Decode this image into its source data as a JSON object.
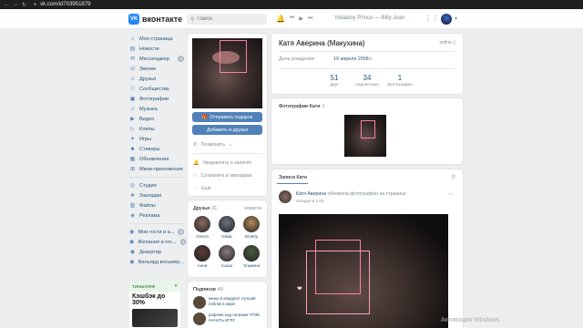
{
  "browser": {
    "url": "vk.com/id703951879",
    "nav_back": "←",
    "nav_forward": "→",
    "nav_reload": "↻",
    "lock_glyph": "🔒"
  },
  "header": {
    "logo_mark": "VK",
    "logo_text": "вконтакте",
    "search_placeholder": "Поиск",
    "now_playing": "Maladoy Prince — Billy Jean",
    "icons": [
      "bell-icon",
      "prev-icon",
      "play-icon",
      "next-icon",
      "apps-icon"
    ]
  },
  "menu": {
    "items": [
      {
        "label": "Моя страница",
        "icon": "⌂",
        "badge": ""
      },
      {
        "label": "Новости",
        "icon": "▤",
        "badge": ""
      },
      {
        "label": "Мессенджер",
        "icon": "✉",
        "badge": "8"
      },
      {
        "label": "Звонки",
        "icon": "☏",
        "badge": ""
      },
      {
        "label": "Друзья",
        "icon": "☺",
        "badge": ""
      },
      {
        "label": "Сообщества",
        "icon": "⚇",
        "badge": ""
      },
      {
        "label": "Фотографии",
        "icon": "▣",
        "badge": ""
      },
      {
        "label": "Музыка",
        "icon": "♫",
        "badge": ""
      },
      {
        "label": "Видео",
        "icon": "▶",
        "badge": ""
      },
      {
        "label": "Клипы",
        "icon": "▷",
        "badge": ""
      },
      {
        "label": "Игры",
        "icon": "✦",
        "badge": ""
      },
      {
        "label": "Стикеры",
        "icon": "☻",
        "badge": ""
      },
      {
        "label": "Объявления",
        "icon": "▦",
        "badge": ""
      },
      {
        "label": "Мини-приложения",
        "icon": "⊞",
        "badge": ""
      }
    ],
    "items2": [
      {
        "label": "Студия",
        "icon": "◎",
        "badge": ""
      },
      {
        "label": "Закладки",
        "icon": "★",
        "badge": ""
      },
      {
        "label": "Файлы",
        "icon": "▥",
        "badge": ""
      },
      {
        "label": "Реклама",
        "icon": "◈",
        "badge": ""
      }
    ],
    "items3": [
      {
        "label": "Мои гости и а...",
        "icon": "◉",
        "badge": "8"
      },
      {
        "label": "Желания и гос...",
        "icon": "◉",
        "badge": "5"
      },
      {
        "label": "Дезертир",
        "icon": "◉",
        "badge": ""
      },
      {
        "label": "Бильярд восьмёр...",
        "icon": "◉",
        "badge": ""
      }
    ]
  },
  "ad": {
    "brand": "ТИНЬКОФФ",
    "close": "✕",
    "headline": "Кэшбэк до 30%"
  },
  "left_card": {
    "gift_button": "Отправить подарок",
    "friend_button": "Добавить в друзья",
    "call_label": "Позвонить",
    "actions": [
      {
        "label": "Уведомлять о записях",
        "icon": "🔔"
      },
      {
        "label": "Сохранить в закладках",
        "icon": "☆"
      },
      {
        "label": "Ещё",
        "icon": "⋯"
      }
    ]
  },
  "friends": {
    "title": "Друзья",
    "count": "31",
    "link": "новости",
    "list": [
      {
        "name": "Олеся",
        "color": "#8a6a60"
      },
      {
        "name": "Nikita",
        "color": "#6a7480"
      },
      {
        "name": "Dmitriy",
        "color": "#b08a5a"
      },
      {
        "name": "Анна",
        "color": "#5a3a3a"
      },
      {
        "name": "Саша",
        "color": "#8a7a80"
      },
      {
        "name": "Эльвина",
        "color": "#4a5a40"
      }
    ]
  },
  "subscriptions": {
    "title": "Подписки",
    "count": "49",
    "list": [
      {
        "text": "мемы в квадрате лучший паблик в мире"
      },
      {
        "text": "рофлим над неграми ЧТОБ НАЧАТЬ ИГРУ"
      }
    ]
  },
  "profile": {
    "name": "Катя Аверина (Макухина)",
    "status": "online",
    "birth_label": "День рождения:",
    "birth_value": "19 апреля 2008 г.",
    "stats": [
      {
        "num": "51",
        "label": "друг"
      },
      {
        "num": "34",
        "label": "подписчика"
      },
      {
        "num": "1",
        "label": "фотография"
      }
    ]
  },
  "photos_block": {
    "title": "Фотографии Кати",
    "count": "1"
  },
  "wall": {
    "tab": "Записи Кати",
    "author": "Катя Аверина",
    "action": "обновила фотографию на странице",
    "time": "сегодня в 1:03"
  },
  "os": {
    "watermark": "Активация Windows"
  }
}
